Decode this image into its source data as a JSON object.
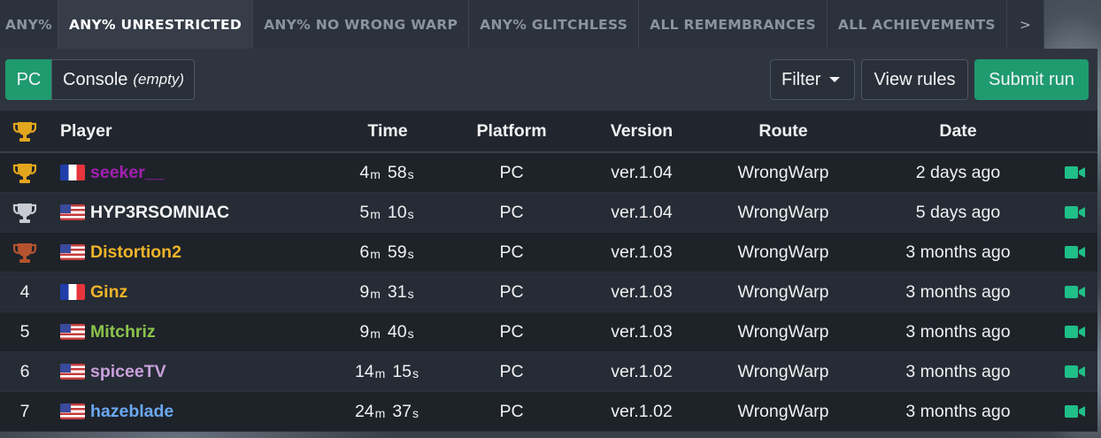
{
  "tabs": [
    {
      "label": "ANY%"
    },
    {
      "label": "ANY% UNRESTRICTED"
    },
    {
      "label": "ANY% NO WRONG WARP"
    },
    {
      "label": "ANY% GLITCHLESS"
    },
    {
      "label": "ALL REMEMBRANCES"
    },
    {
      "label": "ALL ACHIEVEMENTS"
    },
    {
      "label": ">"
    }
  ],
  "toolbar": {
    "platform_pc": "PC",
    "platform_console": "Console",
    "platform_console_note": "(empty)",
    "filter_label": "Filter",
    "view_rules_label": "View rules",
    "submit_label": "Submit run"
  },
  "colors": {
    "accent": "#1f9b70",
    "gold": "#e3a61d",
    "silver": "#c8ccd2",
    "bronze": "#b5532e",
    "video": "#1fbf87"
  },
  "table": {
    "headers": {
      "rank_icon": "trophy-icon",
      "player": "Player",
      "time": "Time",
      "platform": "Platform",
      "version": "Version",
      "route": "Route",
      "date": "Date"
    },
    "rows": [
      {
        "rank": "1",
        "trophy": "gold",
        "flag": "fr",
        "player": "seeker__",
        "player_color": "#a31fb0",
        "time_m": "4",
        "time_s": "58",
        "platform": "PC",
        "version": "ver.1.04",
        "route": "WrongWarp",
        "date": "2 days ago"
      },
      {
        "rank": "2",
        "trophy": "silver",
        "flag": "us",
        "player": "HYP3RSOMNIAC",
        "player_color": "#f5f5f5",
        "time_m": "5",
        "time_s": "10",
        "platform": "PC",
        "version": "ver.1.04",
        "route": "WrongWarp",
        "date": "5 days ago"
      },
      {
        "rank": "3",
        "trophy": "bronze",
        "flag": "us",
        "player": "Distortion2",
        "player_color": "#f0b429",
        "time_m": "6",
        "time_s": "59",
        "platform": "PC",
        "version": "ver.1.03",
        "route": "WrongWarp",
        "date": "3 months ago"
      },
      {
        "rank": "4",
        "trophy": "",
        "flag": "fr",
        "player": "Ginz",
        "player_color": "#f0b429",
        "time_m": "9",
        "time_s": "31",
        "platform": "PC",
        "version": "ver.1.03",
        "route": "WrongWarp",
        "date": "3 months ago"
      },
      {
        "rank": "5",
        "trophy": "",
        "flag": "us",
        "player": "Mitchriz",
        "player_color": "#8bc34a",
        "time_m": "9",
        "time_s": "40",
        "platform": "PC",
        "version": "ver.1.03",
        "route": "WrongWarp",
        "date": "3 months ago"
      },
      {
        "rank": "6",
        "trophy": "",
        "flag": "us",
        "player": "spiceeTV",
        "player_color": "#c9a0dc",
        "time_m": "14",
        "time_s": "15",
        "platform": "PC",
        "version": "ver.1.02",
        "route": "WrongWarp",
        "date": "3 months ago"
      },
      {
        "rank": "7",
        "trophy": "",
        "flag": "us",
        "player": "hazeblade",
        "player_color": "#6aa8f0",
        "time_m": "24",
        "time_s": "37",
        "platform": "PC",
        "version": "ver.1.02",
        "route": "WrongWarp",
        "date": "3 months ago"
      }
    ],
    "time_units": {
      "minutes": "m",
      "seconds": "s"
    },
    "video_icon": "video-camera-icon"
  }
}
